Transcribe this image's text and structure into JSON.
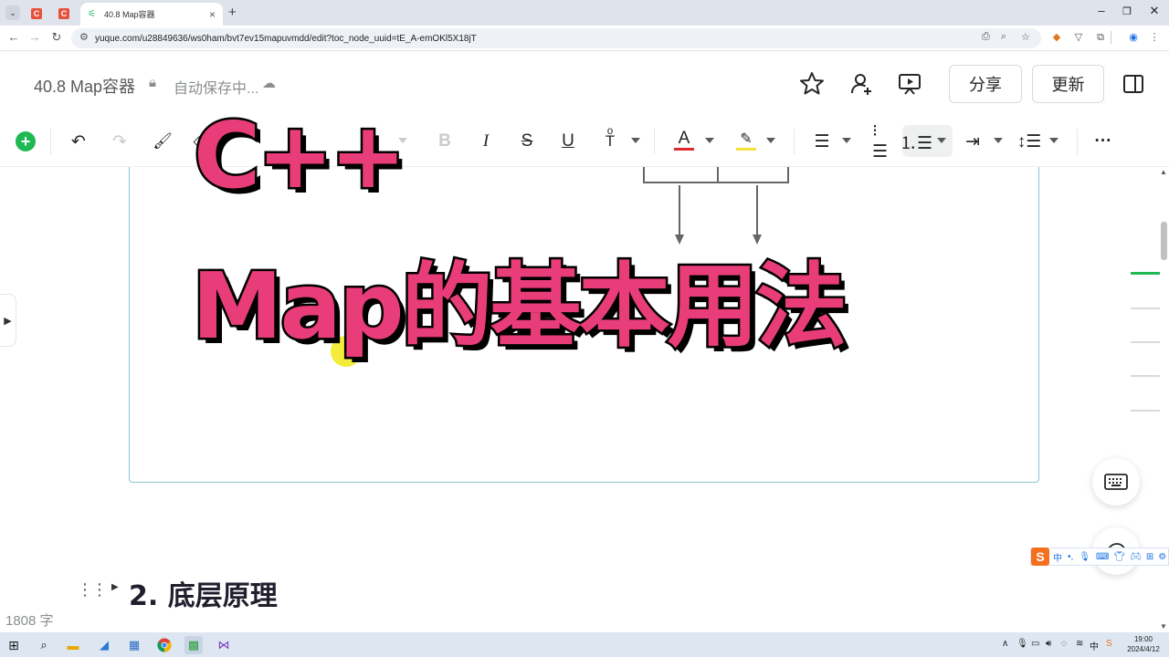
{
  "browser": {
    "active_tab_title": "40.8 Map容器",
    "url": "yuque.com/u28849636/ws0ham/bvt7ev15mapuvmdd/edit?toc_node_uuid=tE_A-emOKl5X18jT",
    "tab_favicon_letter": "C",
    "new_tab": "+",
    "tab_close": "×"
  },
  "doc": {
    "title": "40.8 Map容器",
    "save_status": "自动保存中...",
    "share_label": "分享",
    "update_label": "更新"
  },
  "toolbar": {
    "bold": "B",
    "italic": "I",
    "strike": "S",
    "underline": "U",
    "font_color": "A",
    "more": "···"
  },
  "overlay": {
    "line1": "C++",
    "line2": "Map的基本用法"
  },
  "content": {
    "heading": "2. 底层原理",
    "word_count": "1808 字"
  },
  "ime": {
    "logo": "S",
    "mode": "中"
  },
  "taskbar": {
    "tray_mode": "中",
    "time": "19:00",
    "date": "2024/4/12"
  },
  "colors": {
    "brand_green": "#1fb954",
    "overlay_pink": "#e93d79",
    "frame_border": "#8ac5cf"
  }
}
